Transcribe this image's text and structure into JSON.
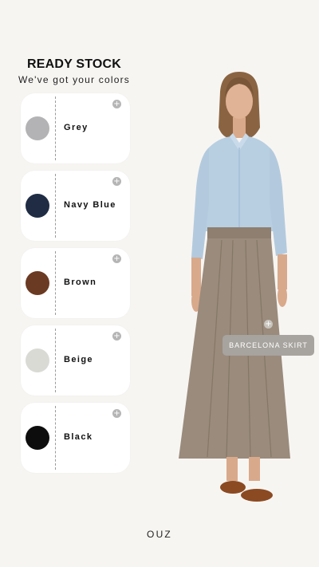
{
  "header": {
    "title": "READY STOCK",
    "subtitle": "We've got your colors"
  },
  "colors": [
    {
      "label": "Grey",
      "swatch": "#b3b3b5"
    },
    {
      "label": "Navy Blue",
      "swatch": "#1f2c44"
    },
    {
      "label": "Brown",
      "swatch": "#6b3a22"
    },
    {
      "label": "Beige",
      "swatch": "#dadad5"
    },
    {
      "label": "Black",
      "swatch": "#0d0d0d"
    }
  ],
  "product_tag": {
    "label": "BARCELONA SKIRT"
  },
  "brand": "OUZ",
  "icons": {
    "card_add": "plus-circle-icon",
    "tag_hotspot": "plus-circle-icon"
  }
}
